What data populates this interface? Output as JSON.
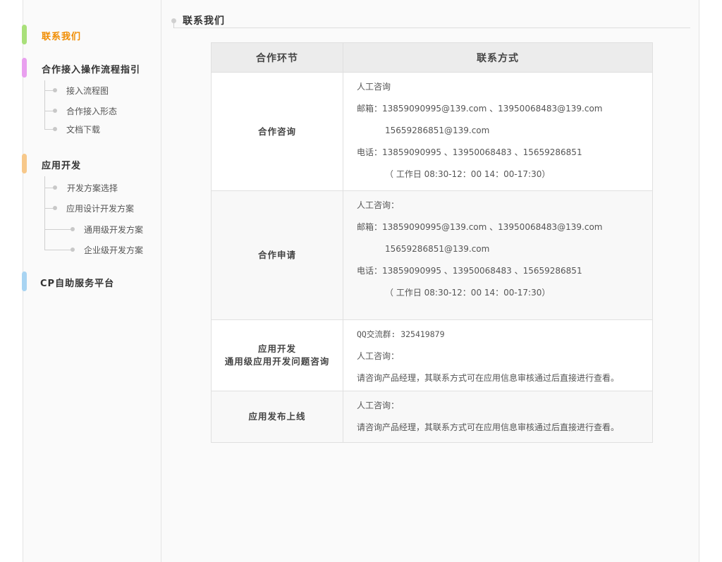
{
  "sidebar": {
    "contact": {
      "label": "联系我们",
      "color": "#a9e07a"
    },
    "guide": {
      "label": "合作接入操作流程指引",
      "color": "#e9a0ef",
      "items": [
        "接入流程图",
        "合作接入形态",
        "文档下载"
      ]
    },
    "dev": {
      "label": "应用开发",
      "color": "#f7c88a",
      "items": [
        "开发方案选择",
        "应用设计开发方案"
      ],
      "subitems": [
        "通用级开发方案",
        "企业级开发方案"
      ]
    },
    "cp": {
      "label": "CP自助服务平台",
      "color": "#a8d4f2"
    }
  },
  "main": {
    "title": "联系我们",
    "table": {
      "headers": [
        "合作环节",
        "联系方式"
      ],
      "rows": [
        {
          "label": [
            "合作咨询"
          ],
          "lines": [
            "人工咨询",
            "邮箱：13859090995@139.com 、13950068483@139.com",
            "15659286851@139.com",
            "电话：13859090995 、13950068483 、15659286851",
            "（ 工作日 08:30-12：00  14：00-17:30）"
          ]
        },
        {
          "label": [
            "合作申请"
          ],
          "lines": [
            "人工咨询：",
            "邮箱：13859090995@139.com 、13950068483@139.com",
            "15659286851@139.com",
            "电话：13859090995 、13950068483 、15659286851",
            "（ 工作日 08:30-12：00  14：00-17:30）"
          ]
        },
        {
          "label": [
            "应用开发",
            "通用级应用开发问题咨询"
          ],
          "lines": [
            "QQ交流群: 325419879",
            "人工咨询：",
            "请咨询产品经理，其联系方式可在应用信息审核通过后直接进行查看。"
          ]
        },
        {
          "label": [
            "应用发布上线"
          ],
          "lines": [
            "人工咨询：",
            "请咨询产品经理，其联系方式可在应用信息审核通过后直接进行查看。"
          ]
        }
      ]
    }
  }
}
